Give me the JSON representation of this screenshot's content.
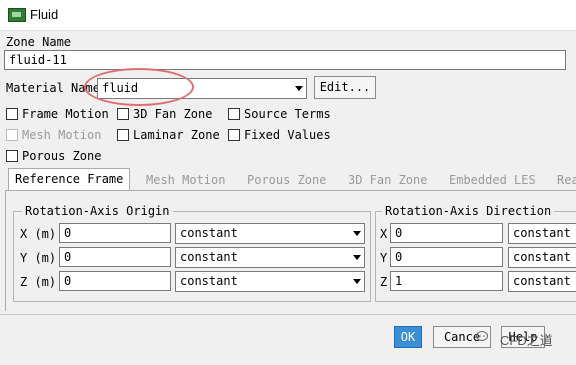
{
  "window": {
    "title": "Fluid"
  },
  "zone_name": {
    "label": "Zone Name",
    "value": "fluid-11"
  },
  "material": {
    "label": "Material Name",
    "value": "fluid",
    "edit_label": "Edit..."
  },
  "options": {
    "frame_motion": "Frame Motion",
    "fan_zone_3d": "3D Fan Zone",
    "source_terms": "Source Terms",
    "mesh_motion": "Mesh Motion",
    "laminar_zone": "Laminar Zone",
    "fixed_values": "Fixed Values",
    "porous_zone": "Porous Zone"
  },
  "tabs": [
    {
      "label": "Reference Frame"
    },
    {
      "label": "Mesh Motion"
    },
    {
      "label": "Porous Zone"
    },
    {
      "label": "3D Fan Zone"
    },
    {
      "label": "Embedded LES"
    },
    {
      "label": "Rea"
    }
  ],
  "rotation_origin": {
    "title": "Rotation-Axis Origin",
    "rows": [
      {
        "label": "X (m)",
        "value": "0",
        "method": "constant"
      },
      {
        "label": "Y (m)",
        "value": "0",
        "method": "constant"
      },
      {
        "label": "Z (m)",
        "value": "0",
        "method": "constant"
      }
    ]
  },
  "rotation_direction": {
    "title": "Rotation-Axis Direction",
    "rows": [
      {
        "label": "X",
        "value": "0",
        "method": "constant"
      },
      {
        "label": "Y",
        "value": "0",
        "method": "constant"
      },
      {
        "label": "Z",
        "value": "1",
        "method": "constant"
      }
    ]
  },
  "buttons": {
    "ok": "OK",
    "cancel": "Cance",
    "help": "Help"
  },
  "watermark": "CFD之道"
}
